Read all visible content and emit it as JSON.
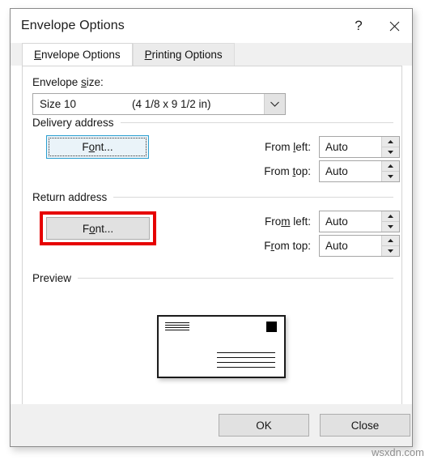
{
  "window": {
    "title": "Envelope Options",
    "help_icon": "question-mark-icon",
    "close_icon": "close-icon"
  },
  "tabs": [
    {
      "label_pre": "",
      "accel": "E",
      "label_post": "nvelope Options",
      "active": true
    },
    {
      "label_pre": "",
      "accel": "P",
      "label_post": "rinting Options",
      "active": false
    }
  ],
  "envelope_size": {
    "label_pre": "Envelope ",
    "label_accel": "s",
    "label_post": "ize:",
    "selected_name": "Size 10",
    "selected_dimensions": "(4 1/8 x 9 1/2 in)",
    "dropdown_icon": "chevron-down-icon"
  },
  "delivery_address": {
    "group_label": "Delivery address",
    "font_button": {
      "pre": "F",
      "accel": "o",
      "post": "nt..."
    },
    "from_left": {
      "label_pre": "From ",
      "label_accel": "l",
      "label_post": "eft:",
      "value": "Auto"
    },
    "from_top": {
      "label_pre": "From ",
      "label_accel": "t",
      "label_post": "op:",
      "value": "Auto"
    }
  },
  "return_address": {
    "group_label": "Return address",
    "font_button": {
      "pre": "F",
      "accel": "o",
      "post": "nt..."
    },
    "from_left": {
      "label_pre": "Fro",
      "label_accel": "m",
      "label_post": " left:",
      "value": "Auto"
    },
    "from_top": {
      "label_pre": "F",
      "label_accel": "r",
      "label_post": "om top:",
      "value": "Auto"
    },
    "highlight_color": "#e60000"
  },
  "preview": {
    "group_label": "Preview",
    "return_address_lines": 4,
    "delivery_address_lines": 4,
    "stamp": "stamp-icon"
  },
  "footer": {
    "ok_label": "OK",
    "close_label": "Close"
  },
  "watermark": {
    "text": "wsxdn.com"
  }
}
